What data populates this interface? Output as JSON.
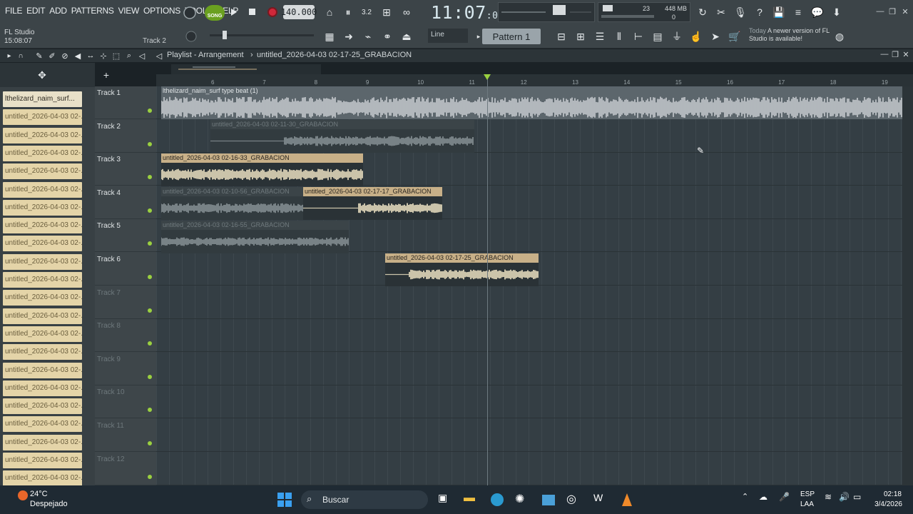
{
  "menu": [
    "FILE",
    "EDIT",
    "ADD",
    "PATTERNS",
    "VIEW",
    "OPTIONS",
    "TOOLS",
    "HELP"
  ],
  "info": {
    "title": "FL Studio",
    "time": "15:08:07",
    "hint": "Track 2"
  },
  "transport": {
    "mode": "SONG",
    "tempo": "140.000",
    "clock_main": "11:07",
    "clock_sub": ":00"
  },
  "monitor": {
    "cpu": "23",
    "memory": "448 MB",
    "polyphony": "0"
  },
  "snap": "Line",
  "pattern": "Pattern 1",
  "news": {
    "label": "Today",
    "text": "A newer version of FL Studio is available!"
  },
  "playlist": {
    "title": "Playlist - Arrangement",
    "arrangement": "untitled_2026-04-03 02-17-25_GRABACION"
  },
  "browser": {
    "items": [
      "lthelizard_naim_surf...",
      "untitled_2026-04-03 02-...",
      "untitled_2026-04-03 02-...",
      "untitled_2026-04-03 02-...",
      "untitled_2026-04-03 02-...",
      "untitled_2026-04-03 02-...",
      "untitled_2026-04-03 02-...",
      "untitled_2026-04-03 02-...",
      "untitled_2026-04-03 02-...",
      "untitled_2026-04-03 02-...",
      "untitled_2026-04-03 02-...",
      "untitled_2026-04-03 02-...",
      "untitled_2026-04-03 02-...",
      "untitled_2026-04-03 02-...",
      "untitled_2026-04-03 02-...",
      "untitled_2026-04-03 02-...",
      "untitled_2026-04-03 02-...",
      "untitled_2026-04-03 02-...",
      "untitled_2026-04-03 02-...",
      "untitled_2026-04-03 02-...",
      "untitled_2026-04-03 02-...",
      "untitled_2026-04-03 02-..."
    ]
  },
  "timeline": {
    "bars": [
      "6",
      "7",
      "8",
      "9",
      "10",
      "11",
      "12",
      "13",
      "14",
      "15",
      "16",
      "17",
      "18",
      "19"
    ]
  },
  "tracks": [
    {
      "label": "Track 1",
      "active": true
    },
    {
      "label": "Track 2",
      "active": true
    },
    {
      "label": "Track 3",
      "active": true
    },
    {
      "label": "Track 4",
      "active": true
    },
    {
      "label": "Track 5",
      "active": true
    },
    {
      "label": "Track 6",
      "active": true
    },
    {
      "label": "Track 7",
      "active": false
    },
    {
      "label": "Track 8",
      "active": false
    },
    {
      "label": "Track 9",
      "active": false
    },
    {
      "label": "Track 10",
      "active": false
    },
    {
      "label": "Track 11",
      "active": false
    },
    {
      "label": "Track 12",
      "active": false
    }
  ],
  "clips": {
    "beat": "lthelizard_naim_surf type beat (1)",
    "t2": "untitled_2026-04-03 02-11-30_GRABACION",
    "t3": "untitled_2026-04-03 02-16-33_GRABACION",
    "t4a": "untitled_2026-04-03 02-10-56_GRABACION",
    "t4b": "untitled_2026-04-03 02-17-17_GRABACION",
    "t5": "untitled_2026-04-03 02-16-55_GRABACION",
    "t6": "untitled_2026-04-03 02-17-25_GRABACION"
  },
  "taskbar": {
    "weather_temp": "24°C",
    "weather_desc": "Despejado",
    "search": "Buscar",
    "lang1": "ESP",
    "lang2": "LAA",
    "time": "02:18",
    "date": "3/4/2026"
  },
  "colors": {
    "accent_green": "#9ad040",
    "clip_active": "#c8b088",
    "record_red": "#d0283a"
  }
}
